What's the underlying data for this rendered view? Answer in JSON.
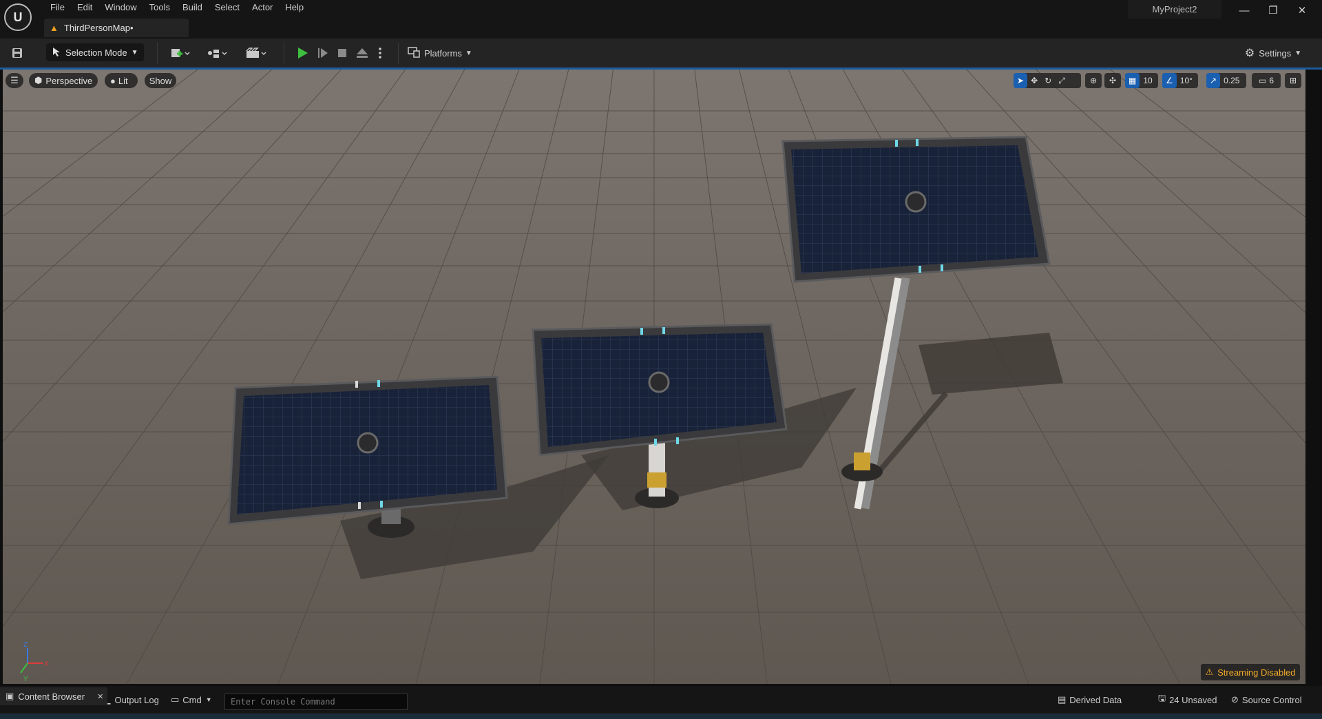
{
  "menu": [
    "File",
    "Edit",
    "Window",
    "Tools",
    "Build",
    "Select",
    "Actor",
    "Help"
  ],
  "document_tab": {
    "label": "ThirdPersonMap•"
  },
  "project_name": "MyProject2",
  "window_controls": {
    "minimize": "—",
    "restore": "❐",
    "close": "✕"
  },
  "toolbar": {
    "selection_mode": "Selection Mode",
    "platforms": "Platforms",
    "settings": "Settings"
  },
  "viewport": {
    "perspective": "Perspective",
    "lit": "Lit",
    "show": "Show",
    "grid_snap": "10",
    "rotation_snap": "10°",
    "scale_snap": "0.25",
    "camera_speed": "6",
    "streaming_warning": "Streaming Disabled",
    "axis_labels": {
      "z": "Z",
      "x": "X",
      "y": "Y"
    }
  },
  "statusbar": {
    "content_browser": "Content Browser",
    "output_log": "Output Log",
    "cmd": "Cmd",
    "console_placeholder": "Enter Console Command",
    "derived_data": "Derived Data",
    "unsaved": "24 Unsaved",
    "source_control": "Source Control"
  },
  "colors": {
    "accent": "#1b5fb1",
    "play_green": "#3fbf3f",
    "warning": "#f0a828",
    "floor": "#6f6862"
  }
}
